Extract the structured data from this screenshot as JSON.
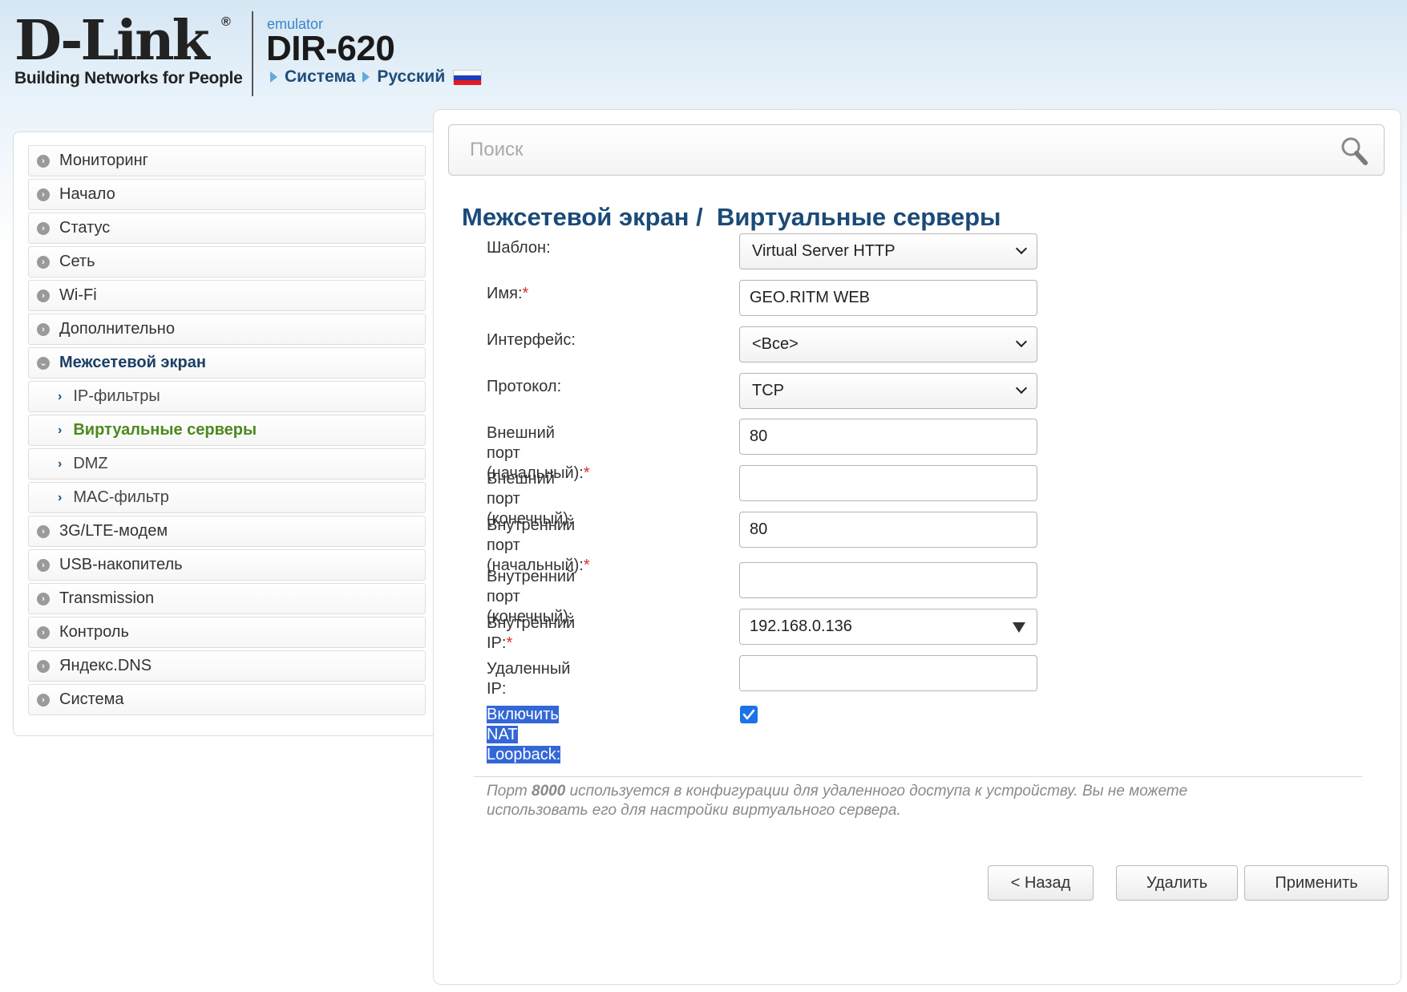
{
  "header": {
    "logo_text": "D-Link",
    "logo_registered": "®",
    "logo_tagline": "Building Networks for People",
    "emulator_label": "emulator",
    "model": "DIR-620",
    "breadcrumb": [
      "Система",
      "Русский"
    ]
  },
  "sidebar": {
    "items": [
      {
        "label": "Мониторинг"
      },
      {
        "label": "Начало"
      },
      {
        "label": "Статус"
      },
      {
        "label": "Сеть"
      },
      {
        "label": "Wi-Fi"
      },
      {
        "label": "Дополнительно"
      },
      {
        "label": "Межсетевой экран"
      },
      {
        "label": "IP-фильтры"
      },
      {
        "label": "Виртуальные серверы"
      },
      {
        "label": "DMZ"
      },
      {
        "label": "MAC-фильтр"
      },
      {
        "label": "3G/LTE-модем"
      },
      {
        "label": "USB-накопитель"
      },
      {
        "label": "Transmission"
      },
      {
        "label": "Контроль"
      },
      {
        "label": "Яндекс.DNS"
      },
      {
        "label": "Система"
      }
    ]
  },
  "search": {
    "placeholder": "Поиск",
    "value": ""
  },
  "page": {
    "title_section": "Межсетевой экран",
    "title_separator": " /  ",
    "title_page": "Виртуальные серверы"
  },
  "form": {
    "template": {
      "label": "Шаблон:",
      "value": "Virtual Server HTTP"
    },
    "name": {
      "label": "Имя:",
      "required_mark": "*",
      "value": "GEO.RITM WEB"
    },
    "interface": {
      "label": "Интерфейс:",
      "value": "<Все>"
    },
    "protocol": {
      "label": "Протокол:",
      "value": "TCP"
    },
    "ext_port_start": {
      "label": "Внешний порт (начальный):",
      "required_mark": "*",
      "value": "80"
    },
    "ext_port_end": {
      "label": "Внешний порт (конечный):",
      "value": ""
    },
    "int_port_start": {
      "label_line1": "Внутренний порт",
      "label_line2": "(начальный):",
      "required_mark": "*",
      "value": "80"
    },
    "int_port_end": {
      "label": "Внутренний порт (конечный):",
      "value": ""
    },
    "internal_ip": {
      "label": "Внутренний IP:",
      "required_mark": "*",
      "value": "192.168.0.136"
    },
    "remote_ip": {
      "label": "Удаленный IP:",
      "value": ""
    },
    "nat_loopback": {
      "label": "Включить NAT Loopback:",
      "checked": true
    }
  },
  "note": {
    "part1": "Порт ",
    "port": "8000",
    "part2": " используется в конфигурации для удаленного доступа к устройству. Вы не можете использовать его для настройки виртуального сервера."
  },
  "buttons": {
    "back": "< Назад",
    "delete": "Удалить",
    "apply": "Применить"
  },
  "colors": {
    "title": "#1b4a78",
    "active_menu": "#4a8a1c",
    "required": "#d9302c",
    "checkbox": "#1a73e8",
    "selection_highlight": "#3367d6"
  }
}
